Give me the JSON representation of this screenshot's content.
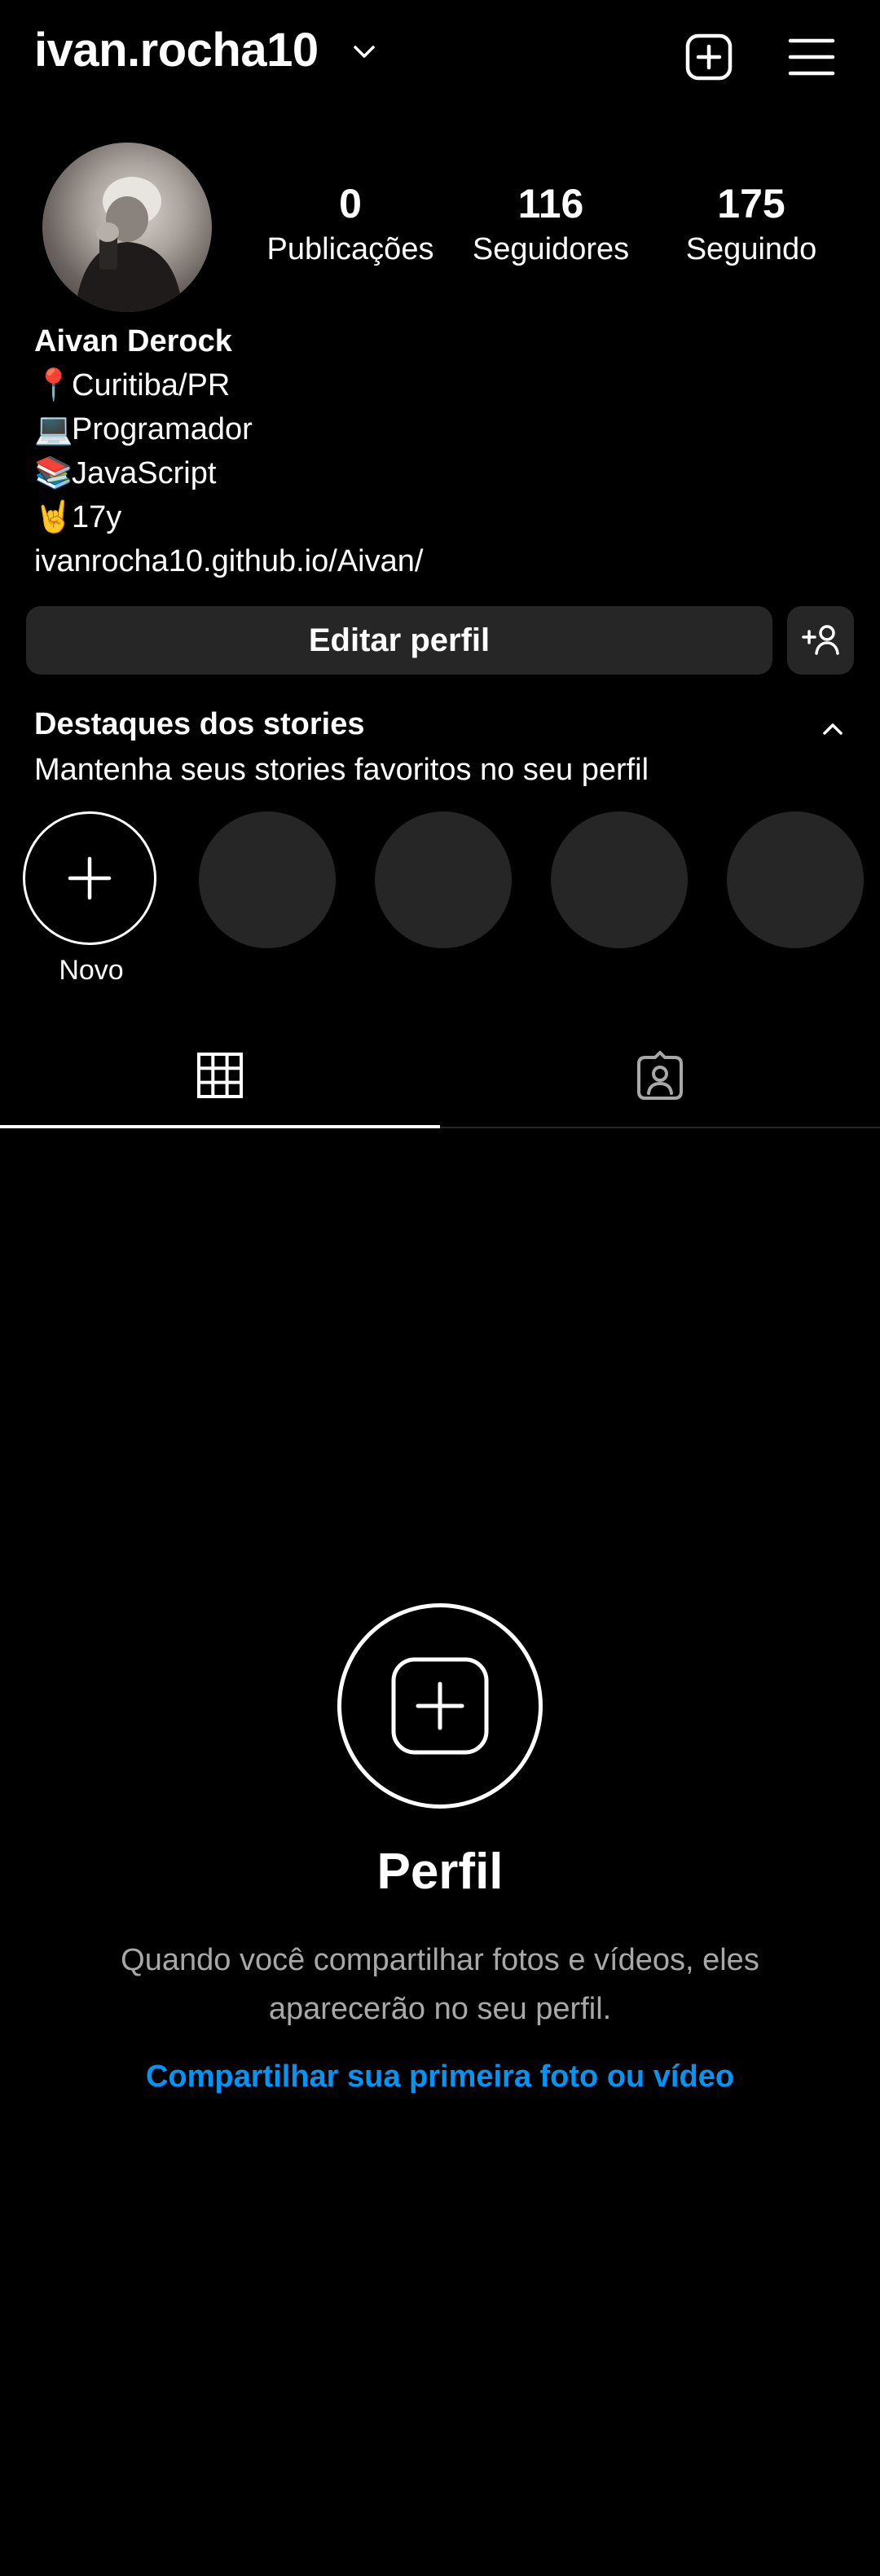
{
  "header": {
    "username": "ivan.rocha10",
    "caret_icon": "chevron-down-icon",
    "create_icon": "plus-square-icon",
    "menu_icon": "hamburger-menu-icon"
  },
  "profile": {
    "avatar_icon": "profile-avatar",
    "stats": [
      {
        "value": "0",
        "label": "Publicações"
      },
      {
        "value": "116",
        "label": "Seguidores"
      },
      {
        "value": "175",
        "label": "Seguindo"
      }
    ],
    "name": "Aivan Derock",
    "bio": [
      {
        "emoji": "📍",
        "text": "Curitiba/PR"
      },
      {
        "emoji": "💻",
        "text": "Programador"
      },
      {
        "emoji": "📚",
        "text": "JavaScript"
      },
      {
        "emoji": "🤘",
        "text": "17y"
      }
    ],
    "link": "ivanrocha10.github.io/Aivan/"
  },
  "actions": {
    "edit_label": "Editar perfil",
    "add_user_icon": "add-person-icon"
  },
  "highlights": {
    "title": "Destaques dos stories",
    "subtitle": "Mantenha seus stories favoritos no seu perfil",
    "new_label": "Novo",
    "collapse_icon": "chevron-up-icon"
  },
  "tabs": [
    {
      "name": "posts-grid",
      "icon": "grid-icon",
      "active": true
    },
    {
      "name": "tagged",
      "icon": "tagged-person-icon",
      "active": false
    }
  ],
  "empty_state": {
    "title": "Perfil",
    "description": "Quando você compartilhar fotos e vídeos, eles aparecerão no seu perfil.",
    "link": "Compartilhar sua primeira foto ou vídeo"
  },
  "colors": {
    "background": "#000000",
    "surface": "#262626",
    "muted_text": "#a8a8a8",
    "link": "#0095f6"
  }
}
